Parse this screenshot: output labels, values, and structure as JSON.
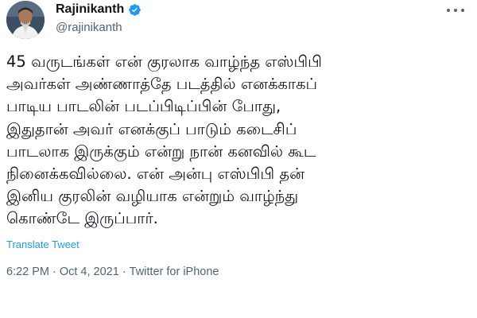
{
  "tweet": {
    "author": {
      "display_name": "Rajinikanth",
      "handle": "@rajinikanth",
      "verified_icon": "verified-badge-icon",
      "verified_color": "#1d9bf0"
    },
    "more_icon": "more-options-icon",
    "body_lines": [
      "45 வருடங்கள் என் குரலாக வாழ்ந்த எஸ்பிபி",
      "அவர்கள் அண்ணாத்தே படத்தில் எனக்காகப்",
      "பாடிய பாடலின் படப்பிடிப்பின் போது,",
      "இதுதான் அவர் எனக்குப் பாடும் கடைசிப்",
      "பாடலாக இருக்கும் என்று நான் கனவில் கூட",
      "நினைக்கவில்லை. என் அன்பு எஸ்பிபி தன்",
      "இனிய குரலின் வழியாக என்றும் வாழ்ந்து",
      "கொண்டே இருப்பார்."
    ],
    "translate_label": "Translate Tweet",
    "time": "6:22 PM",
    "separator_1": "·",
    "date": "Oct 4, 2021",
    "separator_2": "·",
    "source": "Twitter for iPhone"
  },
  "colors": {
    "text": "#0f1419",
    "secondary": "#536471",
    "link": "#1d9bf0"
  }
}
